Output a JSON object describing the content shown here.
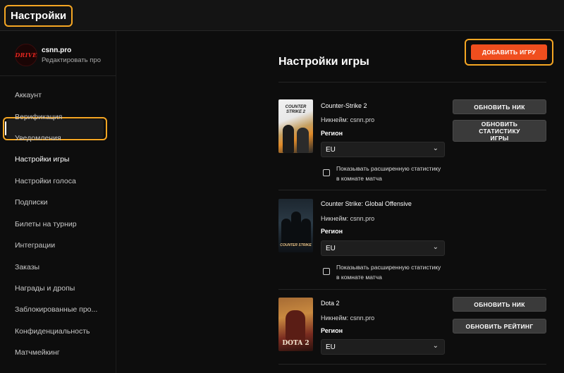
{
  "header": {
    "title": "Настройки"
  },
  "profile": {
    "avatar_text": "DRIVE",
    "name": "csnn.pro",
    "edit_label": "Редактировать про"
  },
  "sidebar": {
    "items": [
      {
        "label": "Аккаунт"
      },
      {
        "label": "Верификация"
      },
      {
        "label": "Уведомления"
      },
      {
        "label": "Настройки игры",
        "active": true
      },
      {
        "label": "Настройки голоса"
      },
      {
        "label": "Подписки"
      },
      {
        "label": "Билеты на турнир"
      },
      {
        "label": "Интеграции"
      },
      {
        "label": "Заказы"
      },
      {
        "label": "Награды и дропы"
      },
      {
        "label": "Заблокированные про..."
      },
      {
        "label": "Конфиденциальность"
      },
      {
        "label": "Матчмейкинг"
      }
    ]
  },
  "main": {
    "title": "Настройки игры",
    "add_game_label": "ДОБАВИТЬ ИГРУ",
    "games": [
      {
        "name": "Counter-Strike 2",
        "nickname": "Никнейм: csnn.pro",
        "region_label": "Регион",
        "region_value": "EU",
        "checkbox_label": "Показывать расширенную статистику в комнате матча",
        "image_text": "COUNTER STRIKE 2",
        "button1": "ОБНОВИТЬ НИК",
        "button2": "ОБНОВИТЬ СТАТИСТИКУ ИГРЫ"
      },
      {
        "name": "Counter Strike: Global Offensive",
        "nickname": "Никнейм: csnn.pro",
        "region_label": "Регион",
        "region_value": "EU",
        "checkbox_label": "Показывать расширенную статистику в комнате матча",
        "image_text": "COUNTER STRIKE"
      },
      {
        "name": "Dota 2",
        "nickname": "Никнейм: csnn.pro",
        "region_label": "Регион",
        "region_value": "EU",
        "image_text": "DOTA 2",
        "button1": "ОБНОВИТЬ НИК",
        "button2": "ОБНОВИТЬ РЕЙТИНГ"
      }
    ]
  },
  "colors": {
    "accent_orange": "#f04e1e",
    "highlight_outline": "#f5a623",
    "background": "#0d0d0d"
  }
}
